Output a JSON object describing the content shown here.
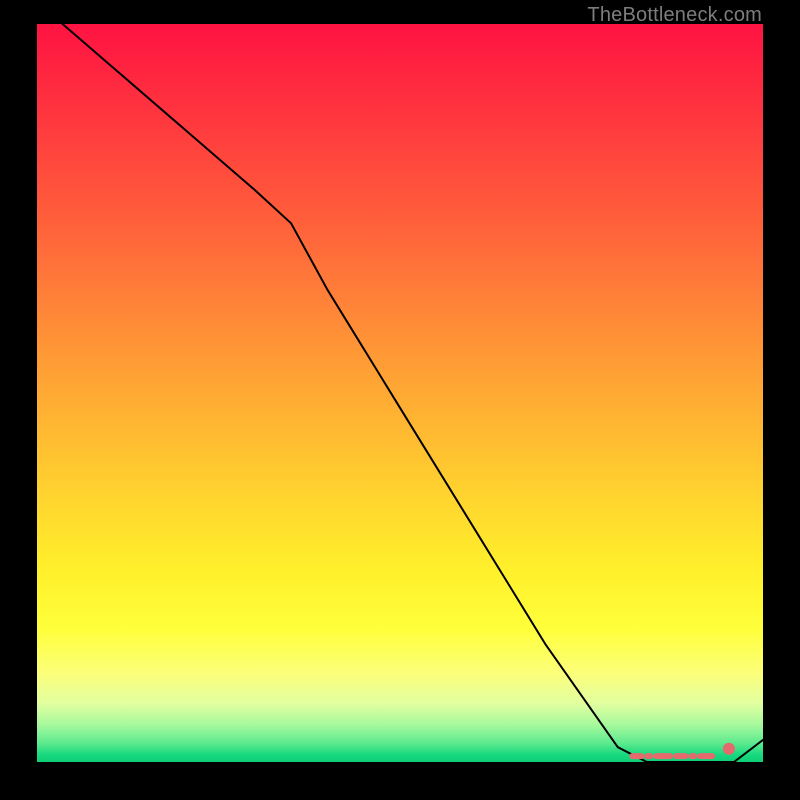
{
  "attribution": "TheBottleneck.com",
  "chart_data": {
    "type": "line",
    "title": "",
    "xlabel": "",
    "ylabel": "",
    "xlim": [
      0,
      100
    ],
    "ylim": [
      0,
      100
    ],
    "series": [
      {
        "name": "curve",
        "x": [
          0,
          10,
          20,
          30,
          35,
          40,
          50,
          60,
          70,
          80,
          84,
          88,
          92,
          96,
          100
        ],
        "y": [
          103,
          94.5,
          86,
          77.5,
          73,
          64,
          48,
          32,
          16,
          2,
          0,
          0,
          0,
          0,
          3
        ]
      }
    ],
    "markers": [
      {
        "shape": "dot",
        "x": 95.3,
        "y": 1.8,
        "color": "#e46a6d",
        "r": 6
      },
      {
        "shape": "dashed-run",
        "x0": 82,
        "x1": 93,
        "y": 0.8,
        "color": "#e46a6d",
        "thickness": 6
      }
    ]
  },
  "colors": {
    "line": "#000000",
    "marker": "#e46a6d"
  }
}
